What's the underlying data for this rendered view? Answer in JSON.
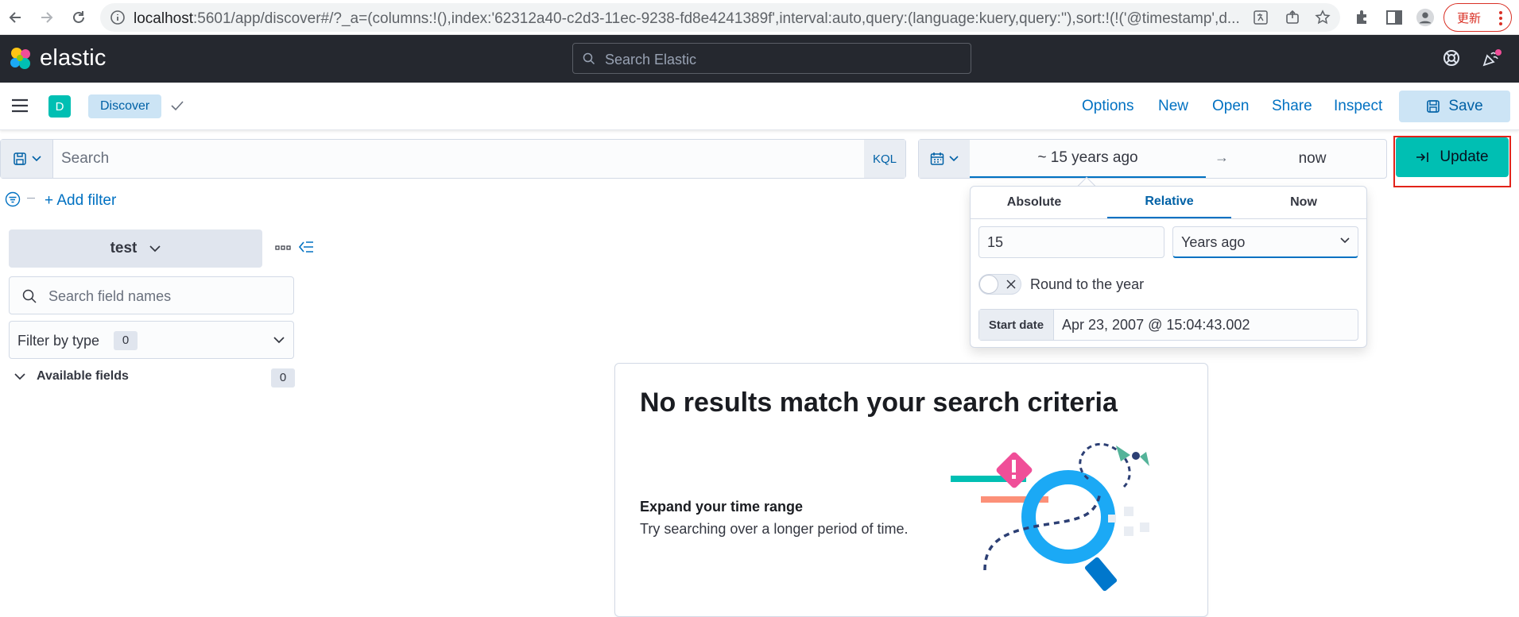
{
  "browser": {
    "url_host": "localhost",
    "url_path": ":5601/app/discover#/?_a=(columns:!(),index:'62312a40-c2d3-11ec-9238-fd8e4241389f',interval:auto,query:(language:kuery,query:''),sort:!(!('@timestamp',d...",
    "update_label": "更新"
  },
  "header": {
    "logo_text": "elastic",
    "search_placeholder": "Search Elastic"
  },
  "appbar": {
    "space_initial": "D",
    "breadcrumb": "Discover",
    "links": [
      "Options",
      "New",
      "Open",
      "Share",
      "Inspect"
    ],
    "save_label": "Save"
  },
  "query": {
    "placeholder": "Search",
    "language": "KQL"
  },
  "time": {
    "start": "~ 15 years ago",
    "arrow": "→",
    "end": "now",
    "update_label": "Update"
  },
  "filters": {
    "add_label": "+ Add filter"
  },
  "sidebar": {
    "index_pattern": "test",
    "field_search_placeholder": "Search field names",
    "filter_by_type_label": "Filter by type",
    "filter_by_type_count": "0",
    "available_fields_label": "Available fields",
    "available_fields_count": "0"
  },
  "date_popover": {
    "tabs": [
      "Absolute",
      "Relative",
      "Now"
    ],
    "active_tab": "Relative",
    "amount": "15",
    "unit": "Years ago",
    "round_label": "Round to the year",
    "round_enabled": false,
    "start_date_label": "Start date",
    "start_date_value": "Apr 23, 2007 @ 15:04:43.002"
  },
  "empty_state": {
    "title": "No results match your search criteria",
    "subtitle": "Expand your time range",
    "text": "Try searching over a longer period of time."
  },
  "colors": {
    "header_bg": "#25282f",
    "accent": "#0071c2",
    "update_green": "#00bfb3",
    "highlight_red": "#e2231a"
  }
}
